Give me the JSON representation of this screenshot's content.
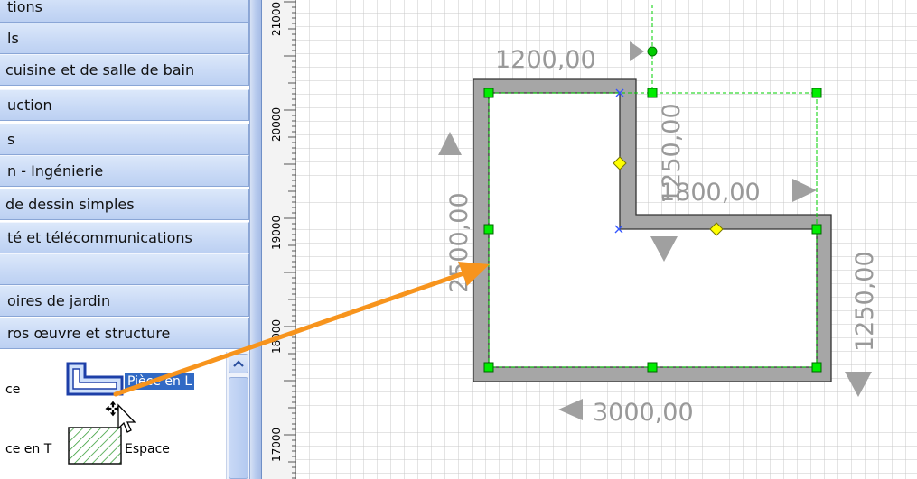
{
  "stencil_categories": [
    {
      "label": "tions"
    },
    {
      "label": "ls"
    },
    {
      "label": " cuisine et de salle de bain"
    },
    {
      "label": "uction"
    },
    {
      "label": "s"
    },
    {
      "label": "n - Ingénierie"
    },
    {
      "label": " de dessin simples"
    },
    {
      "label": "té et télécommunications"
    },
    {
      "label": ""
    },
    {
      "label": "oires de jardin"
    },
    {
      "label": "ros œuvre et structure"
    }
  ],
  "shapes": {
    "row1_left_label": "ce",
    "row1_selected_label": "Pièce en L",
    "row2_left_label": "ce en T",
    "row2_right_label": "Espace"
  },
  "ruler": {
    "labels": [
      "21000",
      "20000",
      "19000",
      "18000",
      "17000"
    ]
  },
  "dimensions": {
    "top": "1200,00",
    "inner_vertical": "1250,00",
    "inner_horizontal": "1800,00",
    "left": "2500,00",
    "right": "1250,00",
    "bottom": "3000,00"
  },
  "colors": {
    "category_bg": "#c9daf6",
    "wall_fill": "#a6a6a6",
    "selection": "#00cc00",
    "control_handle": "#ffff00",
    "drag_arrow": "#f7941d",
    "dimension_text": "#999999"
  }
}
